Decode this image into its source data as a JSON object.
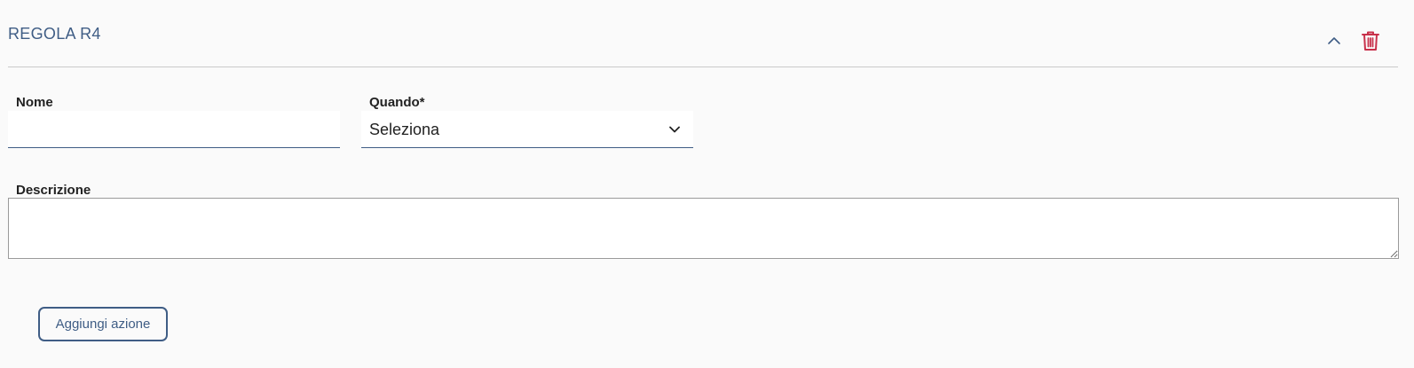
{
  "rule": {
    "title": "REGOLA R4"
  },
  "icons": {
    "collapse": "chevron-up-icon",
    "delete": "trash-icon",
    "select_arrow": "chevron-down-icon"
  },
  "form": {
    "name_label": "Nome",
    "name_value": "",
    "when_label": "Quando*",
    "when_value": "Seleziona",
    "description_label": "Descrizione",
    "description_value": ""
  },
  "actions": {
    "add_action_label": "Aggiungi azione"
  },
  "colors": {
    "accent": "#3f5d85",
    "danger": "#c8304a",
    "background": "#fafafa",
    "divider": "#c9c9c9"
  }
}
